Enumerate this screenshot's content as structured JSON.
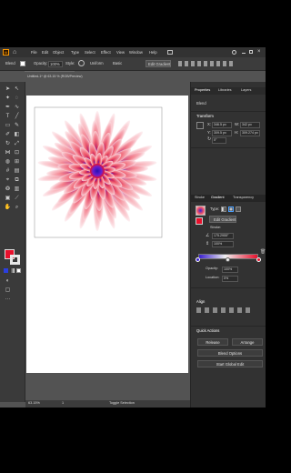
{
  "menu": [
    "File",
    "Edit",
    "Object",
    "Type",
    "Select",
    "Effect",
    "View",
    "Window",
    "Help"
  ],
  "control": {
    "selection_label": "Blend",
    "opacity_label": "Opacity:",
    "opacity_value": "100%",
    "style_label": "Style:",
    "stroke_profile": "Uniform",
    "brush": "Basic",
    "edit_gradient_label": "Edit Gradient"
  },
  "document_tab": "Untitled-1* @ 63.15 % (RGB/Preview)",
  "status": {
    "zoom": "63.15%",
    "page": "1",
    "tool_hint": "Toggle Selection"
  },
  "properties": {
    "tabs": [
      "Properties",
      "Libraries",
      "Layers"
    ],
    "selection": "Blend",
    "transform_title": "Transform",
    "x_label": "X:",
    "x_value": "346.5 px",
    "y_label": "Y:",
    "y_value": "309.5 px",
    "w_label": "W:",
    "w_value": "342 px",
    "h_label": "H:",
    "h_value": "309.274 px",
    "rotation_value": "0°",
    "align_title": "Align",
    "quick_actions_title": "Quick Actions",
    "release_label": "Release",
    "arrange_label": "Arrange",
    "blend_options_label": "Blend Options",
    "start_global_edit_label": "Start Global Edit"
  },
  "gradient": {
    "tabs": [
      "Stroke",
      "Gradient",
      "Transparency"
    ],
    "type_label": "Type:",
    "edit_gradient_label": "Edit Gradient",
    "stroke_label": "Stroke:",
    "angle_value": "175.2955°",
    "aspect_value": "100%",
    "opacity_label": "Opacity:",
    "opacity_value": "100%",
    "location_label": "Location:",
    "location_value": "0%",
    "colors": {
      "start": "#3b1fd1",
      "mid": "#f0f0f0",
      "end": "#e8102c"
    }
  },
  "colors": {
    "fill": "#e8102c",
    "accent": "#2d8ceb",
    "panel_bg": "#323232",
    "artboard": "#ffffff"
  }
}
